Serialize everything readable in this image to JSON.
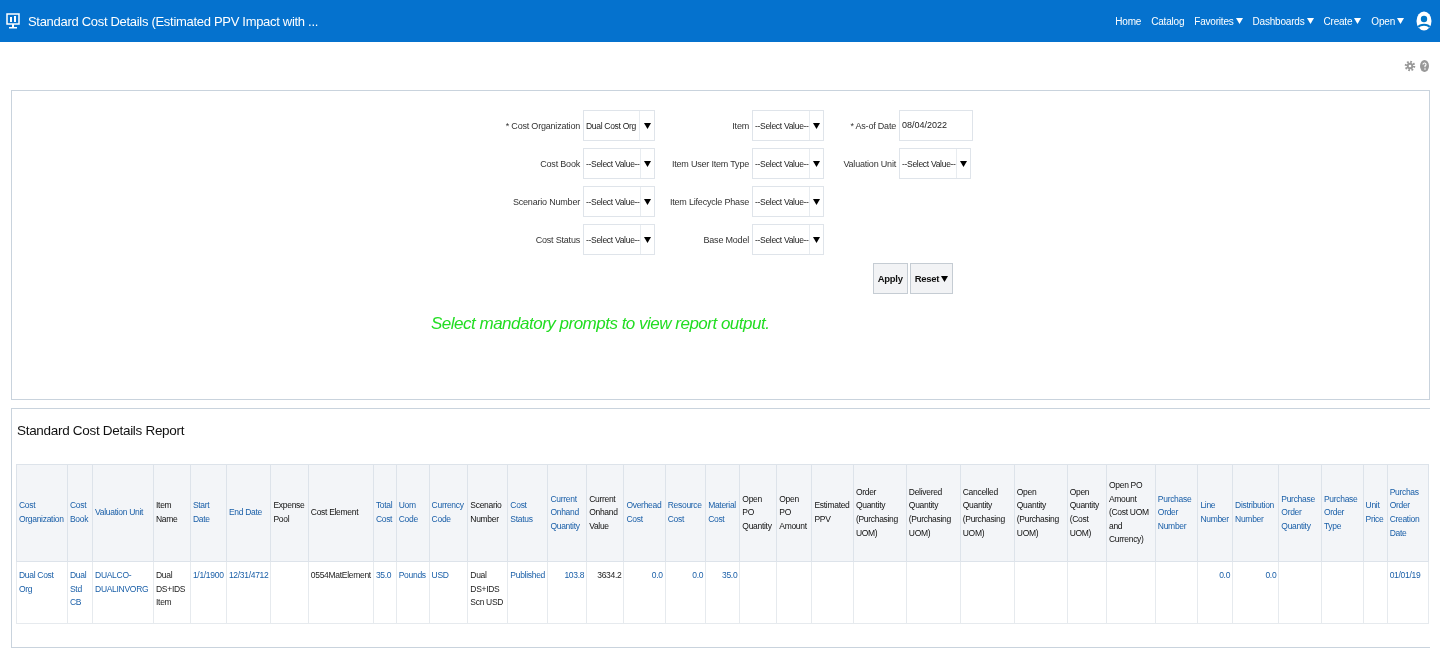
{
  "header": {
    "title": "Standard Cost Details (Estimated PPV Impact with ...",
    "nav": [
      {
        "label": "Home",
        "menu": false
      },
      {
        "label": "Catalog",
        "menu": false
      },
      {
        "label": "Favorites",
        "menu": true
      },
      {
        "label": "Dashboards",
        "menu": true
      },
      {
        "label": "Create",
        "menu": true
      },
      {
        "label": "Open",
        "menu": true
      }
    ]
  },
  "prompts": {
    "columns": [
      [
        {
          "label": "* Cost Organization",
          "kind": "select",
          "value": "Dual Cost Org"
        },
        {
          "label": "Cost Book",
          "kind": "select",
          "value": "--Select Value--"
        },
        {
          "label": "Scenario Number",
          "kind": "select",
          "value": "--Select Value--"
        },
        {
          "label": "Cost Status",
          "kind": "select",
          "value": "--Select Value--"
        }
      ],
      [
        {
          "label": "Item",
          "kind": "select",
          "value": "--Select Value--"
        },
        {
          "label": "Item User Item Type",
          "kind": "select",
          "value": "--Select Value--"
        },
        {
          "label": "Item Lifecycle Phase",
          "kind": "select",
          "value": "--Select Value--"
        },
        {
          "label": "Base Model",
          "kind": "select",
          "value": "--Select Value--"
        }
      ],
      [
        {
          "label": "* As-of Date",
          "kind": "date",
          "value": "08/04/2022"
        },
        {
          "label": "Valuation Unit",
          "kind": "select",
          "value": "--Select Value--"
        }
      ]
    ],
    "apply": "Apply",
    "reset": "Reset",
    "message": "Select mandatory prompts to view report output."
  },
  "report": {
    "title": "Standard Cost Details Report",
    "columns": [
      {
        "label": "Cost Organization",
        "link": true,
        "kind": "text"
      },
      {
        "label": "Cost Book",
        "link": true,
        "kind": "text"
      },
      {
        "label": "Valuation Unit",
        "link": true,
        "kind": "text"
      },
      {
        "label": "Item Name",
        "link": false,
        "kind": "text"
      },
      {
        "label": "Start Date",
        "link": true,
        "kind": "text"
      },
      {
        "label": "End Date",
        "link": true,
        "kind": "text"
      },
      {
        "label": "Expense Pool",
        "link": false,
        "kind": "text"
      },
      {
        "label": "Cost Element",
        "link": false,
        "kind": "text"
      },
      {
        "label": "Total Cost",
        "link": true,
        "kind": "text"
      },
      {
        "label": "Uom Code",
        "link": true,
        "kind": "text"
      },
      {
        "label": "Currency Code",
        "link": true,
        "kind": "text"
      },
      {
        "label": "Scenario Number",
        "link": false,
        "kind": "text"
      },
      {
        "label": "Cost Status",
        "link": true,
        "kind": "text"
      },
      {
        "label": "Current Onhand Quantity",
        "link": true,
        "kind": "number"
      },
      {
        "label": "Current Onhand Value",
        "link": false,
        "kind": "number"
      },
      {
        "label": "Overhead Cost",
        "link": true,
        "kind": "number"
      },
      {
        "label": "Resource Cost",
        "link": true,
        "kind": "number"
      },
      {
        "label": "Material Cost",
        "link": true,
        "kind": "number"
      },
      {
        "label": "Open PO Quantity",
        "link": false,
        "kind": "number"
      },
      {
        "label": "Open PO Amount",
        "link": false,
        "kind": "number"
      },
      {
        "label": "Estimated PPV",
        "link": false,
        "kind": "number"
      },
      {
        "label": "Order Quantity (Purchasing UOM)",
        "link": false,
        "kind": "number"
      },
      {
        "label": "Delivered Quantity (Purchasing UOM)",
        "link": false,
        "kind": "number"
      },
      {
        "label": "Cancelled Quantity (Purchasing UOM)",
        "link": false,
        "kind": "number"
      },
      {
        "label": "Open Quantity (Purchasing UOM)",
        "link": false,
        "kind": "number"
      },
      {
        "label": "Open Quantity (Cost UOM)",
        "link": false,
        "kind": "number"
      },
      {
        "label": "Open PO Amount (Cost UOM and Currency)",
        "link": false,
        "kind": "number"
      },
      {
        "label": "Purchase Order Number",
        "link": true,
        "kind": "text"
      },
      {
        "label": "Line Number",
        "link": true,
        "kind": "number"
      },
      {
        "label": "Distribution Number",
        "link": true,
        "kind": "number"
      },
      {
        "label": "Purchase Order Quantity",
        "link": true,
        "kind": "number"
      },
      {
        "label": "Purchase Order Type",
        "link": true,
        "kind": "text"
      },
      {
        "label": "Unit Price",
        "link": true,
        "kind": "number"
      },
      {
        "label": "Purchas Order Creation Date",
        "link": true,
        "kind": "text"
      }
    ],
    "rows": [
      [
        "Dual Cost Org",
        "Dual Std CB",
        "DUALCO-DUALINVORG",
        "Dual DS+IDS Item",
        "1/1/1900",
        "12/31/4712",
        null,
        "0554MatElement",
        "35.0",
        "Pounds",
        "USD",
        "Dual DS+IDS Scn USD",
        "Published",
        "103.8",
        "3634.2",
        "0.0",
        "0.0",
        "35.0",
        null,
        null,
        null,
        null,
        null,
        null,
        null,
        null,
        null,
        null,
        "0.0",
        "0.0",
        null,
        null,
        null,
        "01/01/19"
      ]
    ]
  }
}
